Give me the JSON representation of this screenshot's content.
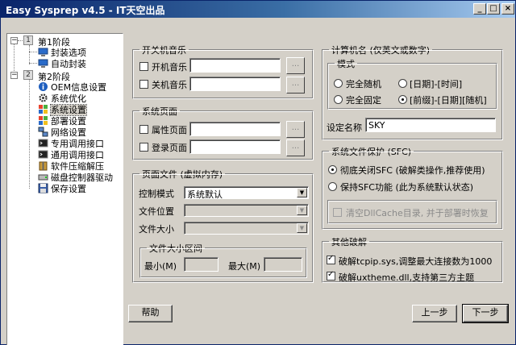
{
  "window": {
    "title": "Easy Sysprep v4.5 - IT天空出品"
  },
  "tree": {
    "stage1": {
      "num": "1",
      "label": "第1阶段",
      "items": [
        {
          "label": "封装选项",
          "icon": "monitor-icon"
        },
        {
          "label": "自动封装",
          "icon": "monitor-icon"
        }
      ]
    },
    "stage2": {
      "num": "2",
      "label": "第2阶段",
      "items": [
        {
          "label": "OEM信息设置",
          "icon": "info-icon"
        },
        {
          "label": "系统优化",
          "icon": "gear-icon"
        },
        {
          "label": "系统设置",
          "icon": "windows-flag-icon"
        },
        {
          "label": "部署设置",
          "icon": "windows-flag-icon"
        },
        {
          "label": "网络设置",
          "icon": "network-icon"
        },
        {
          "label": "专用调用接口",
          "icon": "terminal-icon"
        },
        {
          "label": "通用调用接口",
          "icon": "terminal-icon"
        },
        {
          "label": "软件压缩解压",
          "icon": "archive-icon"
        },
        {
          "label": "磁盘控制器驱动",
          "icon": "disk-icon"
        },
        {
          "label": "保存设置",
          "icon": "save-icon"
        }
      ]
    },
    "selected": "系统设置"
  },
  "boot_music": {
    "title": "开关机音乐",
    "startup_label": "开机音乐",
    "startup_value": "",
    "startup_checked": false,
    "shutdown_label": "关机音乐",
    "shutdown_value": "",
    "shutdown_checked": false,
    "browse_label": "..."
  },
  "system_page": {
    "title": "系统页面",
    "props_label": "属性页面",
    "props_value": "",
    "login_label": "登录页面",
    "login_value": "",
    "browse_label": "..."
  },
  "pagefile": {
    "title": "页面文件 (虚拟内存)",
    "mode_label": "控制模式",
    "mode_value": "系统默认",
    "location_label": "文件位置",
    "location_value": "",
    "size_label": "文件大小",
    "size_value": "",
    "range": {
      "title": "文件大小区间",
      "min_label": "最小(M)",
      "min_value": "",
      "max_label": "最大(M)",
      "max_value": ""
    }
  },
  "computer_name": {
    "title": "计算机名 (仅英文或数字)",
    "mode_title": "模式",
    "options": [
      "完全随机",
      "[日期]-[时间]",
      "完全固定",
      "[前缀]-[日期][随机]"
    ],
    "selected": "[前缀]-[日期][随机]",
    "set_name_label": "设定名称",
    "set_name_value": "SKY"
  },
  "sfc": {
    "title": "系统文件保护 (SFC)",
    "options": [
      "彻底关闭SFC (破解类操作,推荐使用)",
      "保持SFC功能 (此为系统默认状态)"
    ],
    "selected": "彻底关闭SFC (破解类操作,推荐使用)",
    "clear_cache_label": "清空DllCache目录, 并于部署时恢复",
    "clear_cache_checked": false
  },
  "other_crack": {
    "title": "其他破解",
    "tcpip_label": "破解tcpip.sys,调整最大连接数为1000",
    "tcpip_checked": true,
    "uxtheme_label": "破解uxtheme.dll,支持第三方主题",
    "uxtheme_checked": true
  },
  "buttons": {
    "help": "帮助",
    "prev": "上一步",
    "next": "下一步"
  }
}
